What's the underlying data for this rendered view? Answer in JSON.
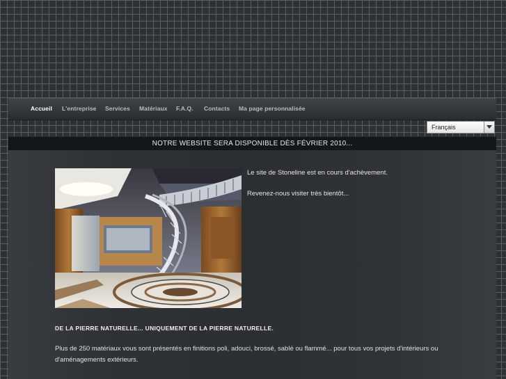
{
  "nav": {
    "items": [
      {
        "label": "Accueil",
        "active": true
      },
      {
        "label": "L'entreprise"
      },
      {
        "label": "Services"
      },
      {
        "label": "Matériaux"
      },
      {
        "label": "F.A.Q."
      },
      {
        "label": "Contacts"
      },
      {
        "label": "Ma page personnalisée"
      }
    ]
  },
  "language": {
    "selected": "Français",
    "icon": "chevron-down-icon"
  },
  "banner": {
    "text": "NOTRE WEBSITE SERA DISPONIBLE DÈS FÉVRIER 2010..."
  },
  "content": {
    "intro_1": "Le site de Stoneline est en cours d'achèvement.",
    "intro_2": "Revenez-nous visiter très bientôt...",
    "headline": "DE LA PIERRE NATURELLE... UNIQUEMENT DE LA PIERRE NATURELLE.",
    "description": "Plus de 250 matériaux vous sont présentés en finitions poli, adouci, brossé, sablé ou flammé... pour tous vos projets d'intérieurs ou d'aménagements extérieurs."
  },
  "colors": {
    "background": "#2e3134",
    "grid_lines": "#5b5f63",
    "banner": "#141617",
    "text": "#e4e4e4"
  }
}
